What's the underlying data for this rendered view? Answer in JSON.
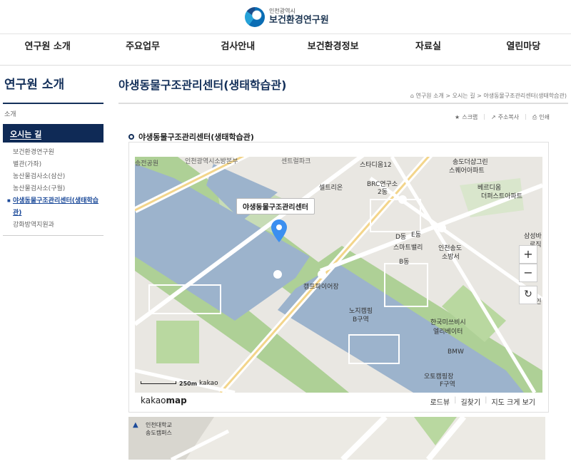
{
  "header": {
    "logo_small": "인천광역시",
    "logo_big": "보건환경연구원"
  },
  "gnb": [
    "연구원 소개",
    "주요업무",
    "검사안내",
    "보건환경정보",
    "자료실",
    "열린마당"
  ],
  "lnb": {
    "title": "연구원 소개",
    "category": "소개",
    "active": "오시는 길",
    "items": [
      "보건환경연구원",
      "별관(가좌)",
      "농산물검사소(삼산)",
      "농산물검사소(구월)",
      "야생동물구조관리센터(생태학습관)",
      "강화방역지원과"
    ]
  },
  "page": {
    "title": "야생동물구조관리센터(생태학습관)",
    "breadcrumb": "연구원 소개 > 오시는 길 > 야생동물구조관리센터(생태학습관)",
    "tools": [
      "스크랩",
      "주소복사",
      "인쇄"
    ],
    "section_title": "야생동물구조관리센터(생태학습관)"
  },
  "map": {
    "marker_label": "야생동물구조관리센터",
    "labels": [
      "송전공원",
      "인천광역시소방본부",
      "센트럴파크",
      "스타디움12",
      "송도더샵그린",
      "스퀘어아파트",
      "셀트리온",
      "BRC연구소",
      "2동",
      "베르디움",
      "더퍼스트아파트",
      "D동",
      "E동",
      "스마트밸리",
      "인천송도",
      "소방서",
      "B동",
      "캠프파이어장",
      "노지캠핑",
      "B구역",
      "한국미쓰비시",
      "엘리베이터",
      "BMW",
      "오토캠핑장",
      "F구역",
      "삼성바",
      "로직",
      "경인"
    ],
    "scale": "250m",
    "scale_brand": "kakao",
    "zoom_in": "+",
    "zoom_out": "−",
    "reset": "↻",
    "brand_light": "kakao",
    "brand_bold": "map",
    "footer_links": [
      "로드뷰",
      "길찾기",
      "지도 크게 보기"
    ],
    "map2_label1": "인천대학교",
    "map2_label2": "송도캠퍼스"
  }
}
